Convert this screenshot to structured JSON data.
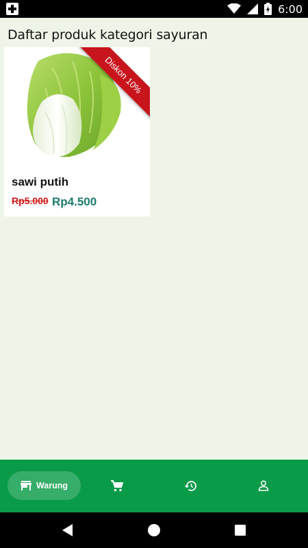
{
  "status_bar": {
    "time": "6:00",
    "icons": [
      "medical-app-icon",
      "wifi-icon",
      "signal-icon",
      "battery-charging-icon"
    ]
  },
  "page": {
    "title": "Daftar produk kategori sayuran"
  },
  "products": [
    {
      "name": "sawi putih",
      "price_original": "Rp5.000",
      "price_discounted": "Rp4.500",
      "discount_label": "Diskon 10%",
      "image": "chinese-cabbage-image"
    }
  ],
  "bottom_nav": {
    "items": [
      {
        "label": "Warung",
        "icon": "store-icon",
        "active": true
      },
      {
        "label": "",
        "icon": "cart-icon",
        "active": false
      },
      {
        "label": "",
        "icon": "history-icon",
        "active": false
      },
      {
        "label": "",
        "icon": "person-icon",
        "active": false
      }
    ]
  },
  "system_nav": {
    "buttons": [
      "back-icon",
      "home-icon",
      "recents-icon"
    ]
  },
  "colors": {
    "background": "#eef5e8",
    "nav_green": "#0a9b48",
    "price_old": "#d01818",
    "price_new": "#1b7a6c",
    "ribbon": "#c8141d"
  }
}
